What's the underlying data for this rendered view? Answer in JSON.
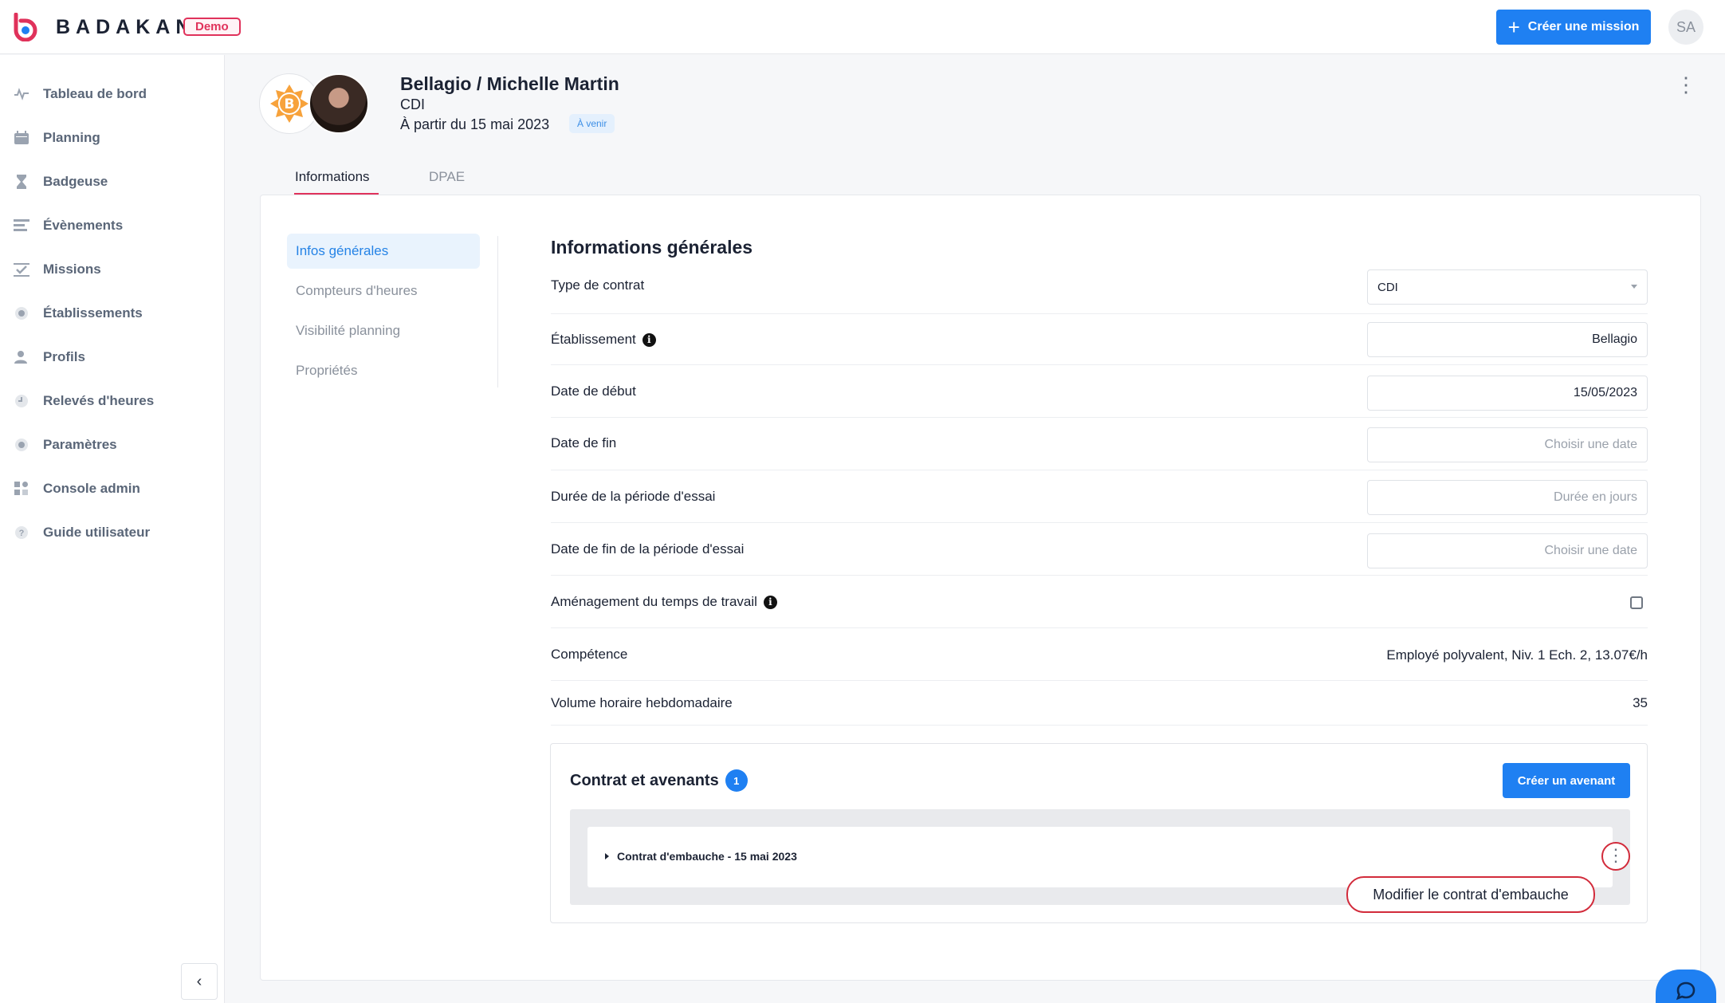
{
  "brand": {
    "name": "BADAKAN",
    "badge": "Demo"
  },
  "topbar": {
    "create_mission_label": "Créer une mission",
    "user_initials": "SA"
  },
  "sidebar": {
    "items": [
      {
        "label": "Tableau de bord",
        "icon": "activity-icon"
      },
      {
        "label": "Planning",
        "icon": "calendar-icon"
      },
      {
        "label": "Badgeuse",
        "icon": "hourglass-icon"
      },
      {
        "label": "Évènements",
        "icon": "list-icon"
      },
      {
        "label": "Missions",
        "icon": "checklist-icon"
      },
      {
        "label": "Établissements",
        "icon": "location-icon"
      },
      {
        "label": "Profils",
        "icon": "users-icon"
      },
      {
        "label": "Relevés d'heures",
        "icon": "clock-icon"
      },
      {
        "label": "Paramètres",
        "icon": "gear-icon"
      },
      {
        "label": "Console admin",
        "icon": "grid-icon"
      },
      {
        "label": "Guide utilisateur",
        "icon": "help-icon"
      }
    ]
  },
  "employee": {
    "name": "Bellagio / Michelle Martin",
    "contract": "CDI",
    "start": "À partir du 15 mai 2023",
    "status": "À venir"
  },
  "tabs": [
    {
      "label": "Informations"
    },
    {
      "label": "DPAE"
    }
  ],
  "subnav": [
    {
      "label": "Infos générales"
    },
    {
      "label": "Compteurs d'heures"
    },
    {
      "label": "Visibilité planning"
    },
    {
      "label": "Propriétés"
    }
  ],
  "general": {
    "title": "Informations générales",
    "contract_type": {
      "label": "Type de contrat",
      "value": "CDI"
    },
    "establishment": {
      "label": "Établissement",
      "value": "Bellagio"
    },
    "start_date": {
      "label": "Date de début",
      "value": "15/05/2023"
    },
    "end_date": {
      "label": "Date de fin",
      "placeholder": "Choisir une date"
    },
    "trial_duration": {
      "label": "Durée de la période d'essai",
      "placeholder": "Durée en jours"
    },
    "trial_end": {
      "label": "Date de fin de la période d'essai",
      "placeholder": "Choisir une date"
    },
    "work_time": {
      "label": "Aménagement du temps de travail",
      "checked": false
    },
    "skill": {
      "label": "Compétence",
      "value": "Employé polyvalent, Niv. 1 Ech. 2, 13.07€/h"
    },
    "weekly_hours": {
      "label": "Volume horaire hebdomadaire",
      "value": "35"
    }
  },
  "contracts": {
    "title": "Contrat et avenants",
    "count": "1",
    "create_label": "Créer un avenant",
    "items": [
      {
        "label": "Contrat d'embauche - 15 mai 2023"
      }
    ],
    "menu": {
      "edit_label": "Modifier le contrat d'embauche"
    }
  },
  "colors": {
    "accent": "#1f80f2",
    "brand_red": "#e0325b",
    "highlight": "#d22b3b"
  }
}
